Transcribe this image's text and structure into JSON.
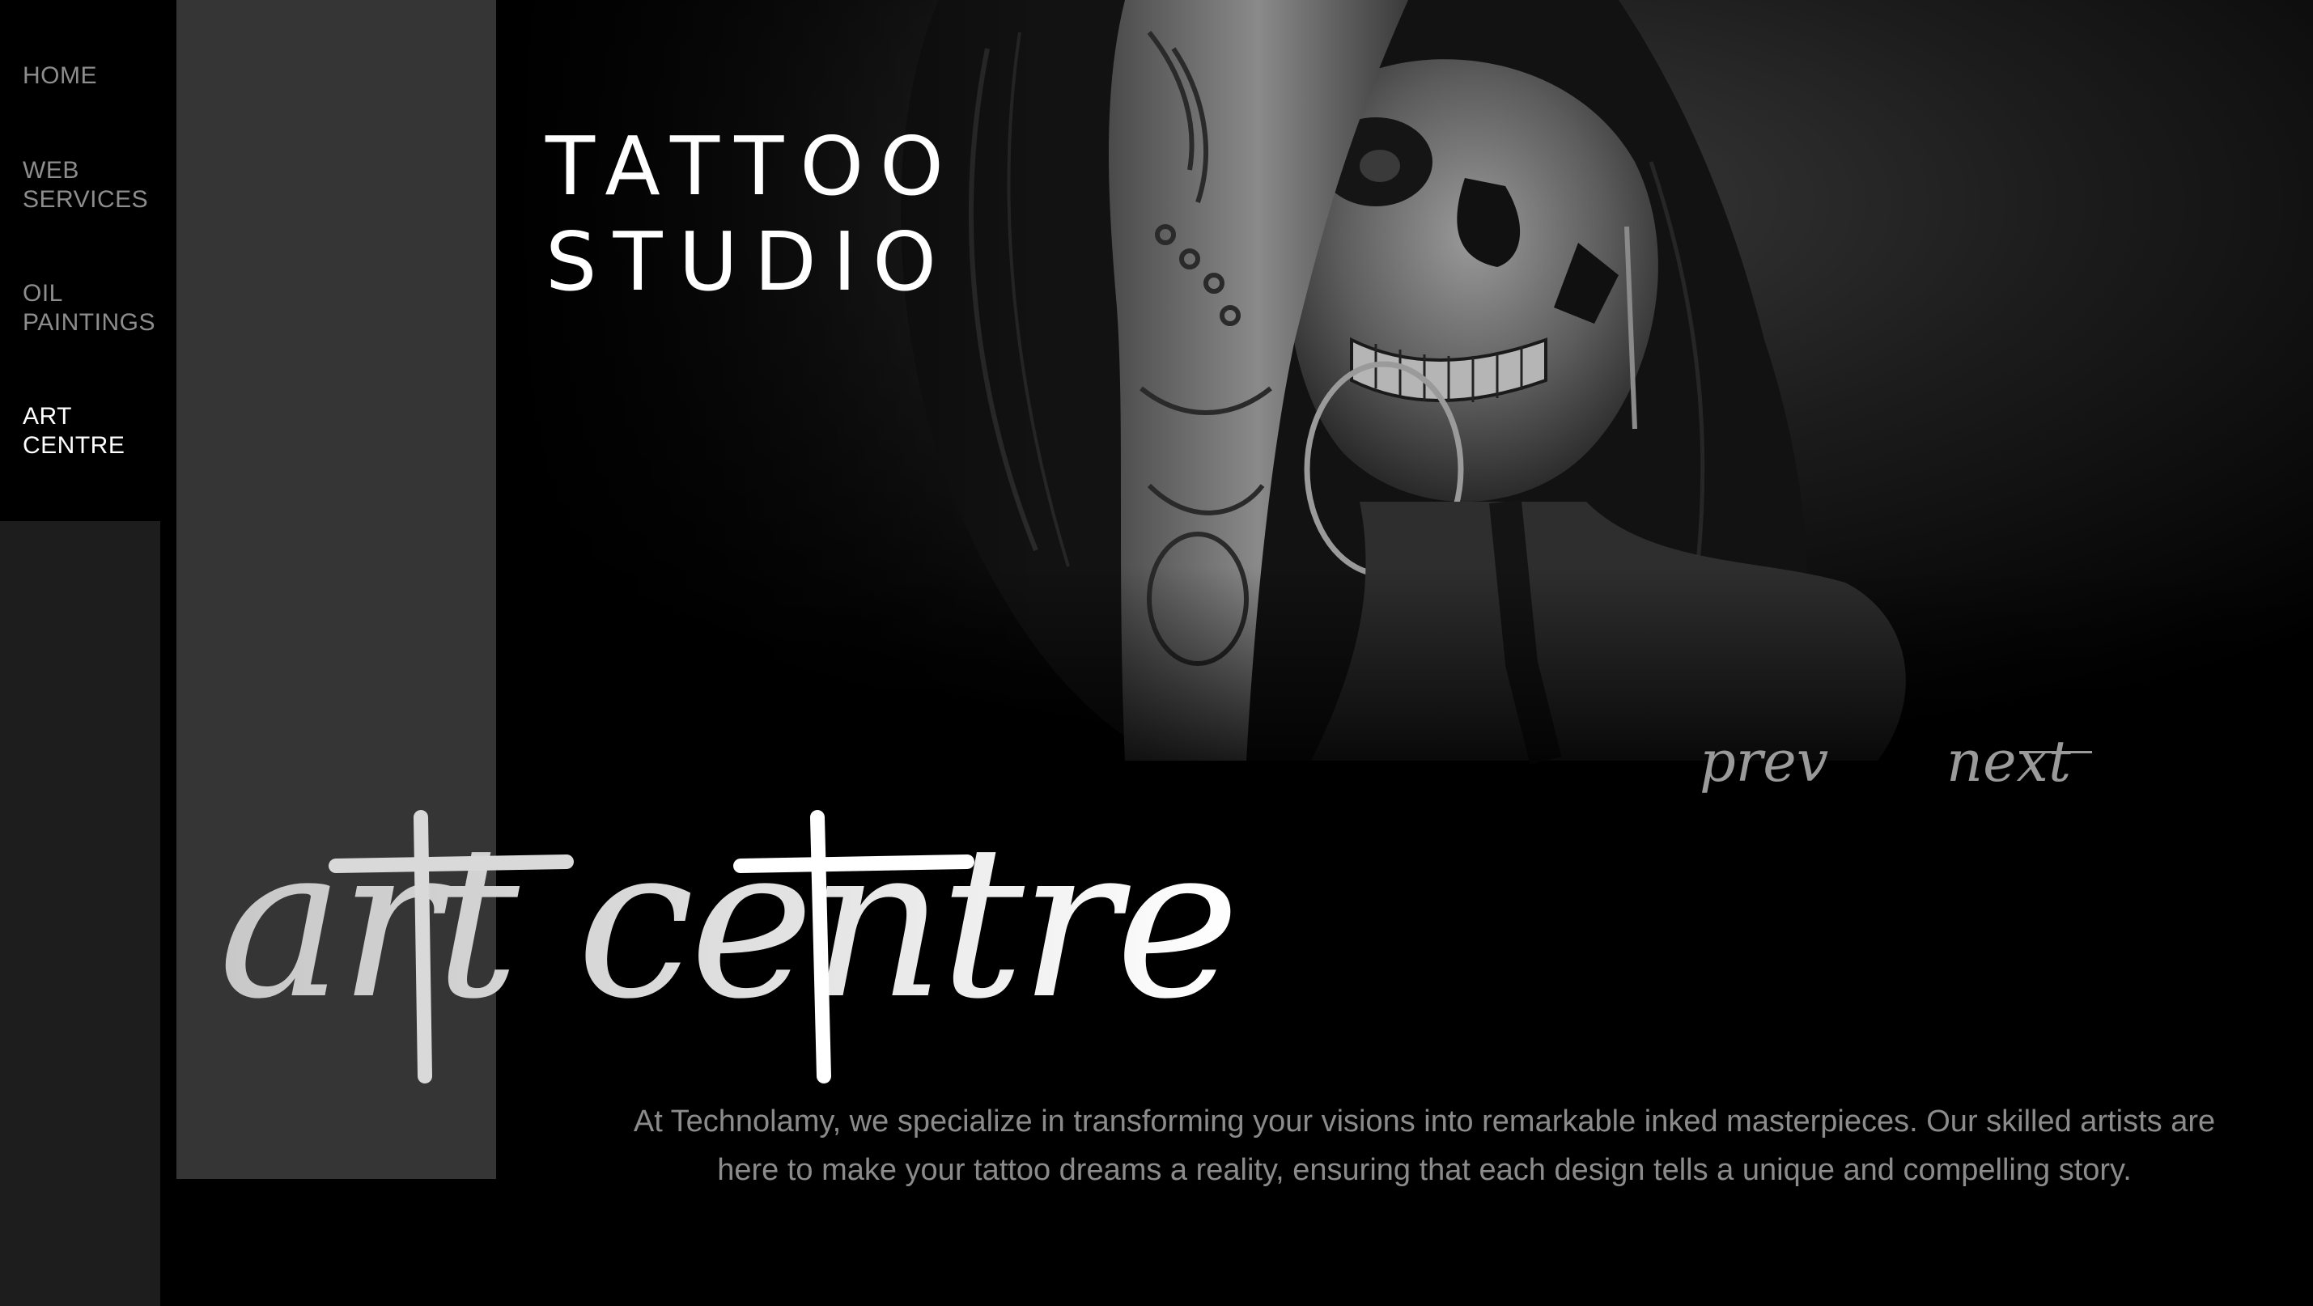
{
  "nav": {
    "items": [
      {
        "label": "HOME",
        "active": false
      },
      {
        "label": "WEB\nSERVICES",
        "active": false
      },
      {
        "label": "OIL\nPAINTINGS",
        "active": false
      },
      {
        "label": "ART\nCENTRE",
        "active": true
      }
    ]
  },
  "hero": {
    "title_line1": "TATTOO",
    "title_line2": "STUDIO",
    "script_text": "art centre",
    "prev_label": "prev",
    "next_label": "next",
    "description": "At Technolamy, we specialize in transforming your visions into remarkable inked masterpieces. Our skilled artists are here to make your tattoo dreams a reality, ensuring that each design tells a unique and compelling story."
  },
  "colors": {
    "background": "#000000",
    "gray_panel": "#353535",
    "side_dark": "#1d1d1d",
    "nav_text": "#8d8d8d",
    "nav_active": "#ffffff",
    "description_text": "#8b8b8b",
    "pager_text": "#9a9a9a"
  }
}
